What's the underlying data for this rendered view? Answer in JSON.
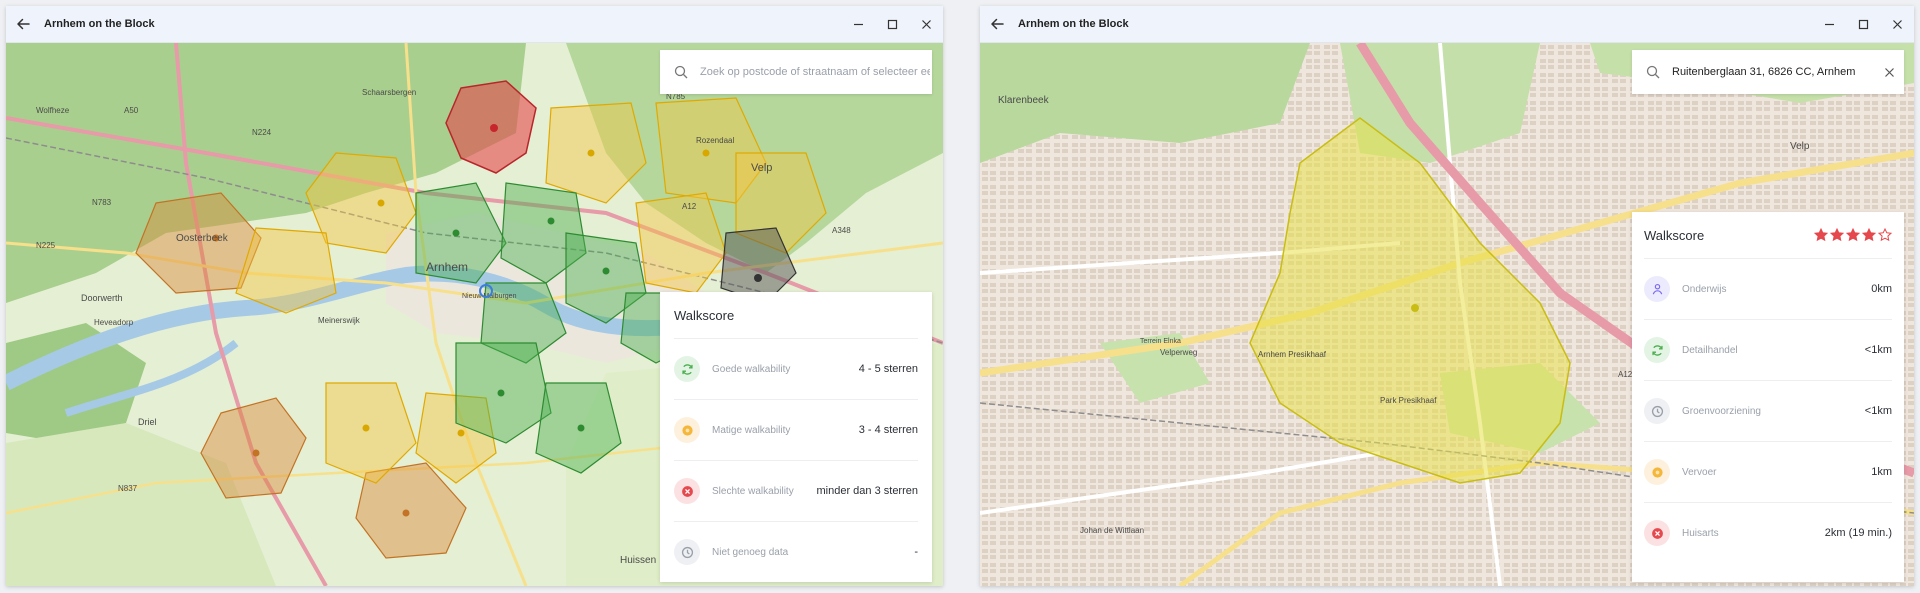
{
  "left": {
    "titlebar": {
      "title": "Arnhem on the Block"
    },
    "search": {
      "placeholder": "Zoek op postcode of straatnaam of selecteer een buurt",
      "value": ""
    },
    "legend": {
      "title": "Walkscore",
      "items": [
        {
          "label": "Goede walkability",
          "value": "4 - 5 sterren",
          "icon": "refresh-icon",
          "color": "#4caf50",
          "bg": "#e3f4e5"
        },
        {
          "label": "Matige walkability",
          "value": "3 - 4 sterren",
          "icon": "sun-icon",
          "color": "#f5b73b",
          "bg": "#fdf1dd"
        },
        {
          "label": "Slechte walkability",
          "value": "minder dan 3 sterren",
          "icon": "close-circle-icon",
          "color": "#e5484d",
          "bg": "#fbe1e2"
        },
        {
          "label": "Niet genoeg data",
          "value": "-",
          "icon": "clock-icon",
          "color": "#9aa0aa",
          "bg": "#eef0f3"
        }
      ]
    },
    "map_labels": {
      "arnhem": "Arnhem",
      "oosterbeek": "Oosterbeek",
      "velp": "Velp",
      "doorwerth": "Doorwerth",
      "heveadorp": "Heveadorp",
      "driel": "Driel",
      "huissen": "Huissen",
      "wolfheze": "Wolfheze",
      "schaarsbergen": "Schaarsbergen",
      "nieuw_malburgen": "Nieuw Malburgen",
      "meinerswijk": "Meinerswijk",
      "rozendaal": "Rozendaal",
      "n225": "N225",
      "n224": "N224",
      "a50": "A50",
      "a12": "A12",
      "n783": "N783",
      "n785": "N785",
      "n837": "N837",
      "a348": "A348"
    }
  },
  "right": {
    "titlebar": {
      "title": "Arnhem on the Block"
    },
    "search": {
      "placeholder": "",
      "value": "Ruitenberglaan 31, 6826 CC, Arnhem"
    },
    "score": {
      "title": "Walkscore",
      "stars_filled": 4,
      "stars_total": 5,
      "star_color": "#e5484d",
      "items": [
        {
          "label": "Onderwijs",
          "value": "0km",
          "icon": "education-icon",
          "color": "#7c6cf2",
          "bg": "#ecebfd"
        },
        {
          "label": "Detailhandel",
          "value": "<1km",
          "icon": "refresh-icon",
          "color": "#4caf50",
          "bg": "#e3f4e5"
        },
        {
          "label": "Groenvoorziening",
          "value": "<1km",
          "icon": "clock-icon",
          "color": "#9aa0aa",
          "bg": "#eef0f3"
        },
        {
          "label": "Vervoer",
          "value": "1km",
          "icon": "sun-icon",
          "color": "#f5b73b",
          "bg": "#fdf1dd"
        },
        {
          "label": "Huisarts",
          "value": "2km (19 min.)",
          "icon": "close-circle-icon",
          "color": "#e5484d",
          "bg": "#fbe1e2"
        }
      ]
    },
    "map_labels": {
      "velp": "Velp",
      "klarenbeek": "Klarenbeek",
      "arnhem_presikhaaf": "Arnhem Presikhaaf",
      "park_presikhaaf": "Park Presikhaaf",
      "velperweg": "Velperweg",
      "a12": "A12",
      "johan_de_wittlaan": "Johan de Wittlaan",
      "terrein_elnka": "Terrein Elnka"
    }
  },
  "colors": {
    "good": "#4caf50",
    "medium": "#f5c542",
    "bad": "#e5484d",
    "orange": "#d9893a",
    "nodata": "#555555"
  }
}
